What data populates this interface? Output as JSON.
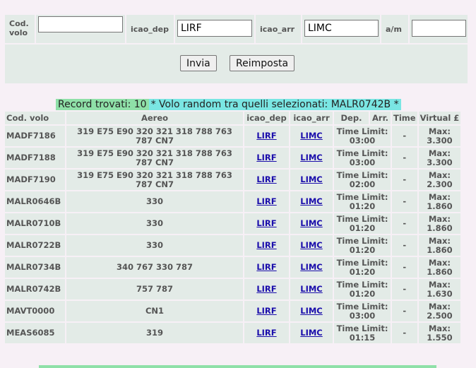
{
  "search": {
    "cod_volo_label_1": "Cod.",
    "cod_volo_label_2": "volo",
    "cod_volo_value": "",
    "icao_dep_label": "icao_dep",
    "icao_dep_value": "LIRF",
    "icao_arr_label": "icao_arr",
    "icao_arr_value": "LIMC",
    "am_label": "a/m",
    "am_value": ""
  },
  "buttons": {
    "submit": "Invia",
    "reset": "Reimposta"
  },
  "banner": {
    "records": "Record trovati: 10",
    "random": "* Volo random tra quelli selezionati: MALR0742B *"
  },
  "table": {
    "headers": [
      "Cod. volo",
      "Aereo",
      "icao_dep",
      "icao_arr",
      "Dep.",
      "Arr.",
      "Time",
      "Virtual £"
    ],
    "rows": [
      {
        "code": "MADF7186",
        "aereo": "319 E75 E90 320 321 318 788 763 787 CN7",
        "dep": "LIRF",
        "arr": "LIMC",
        "tl": "Time Limit:",
        "tv": "03:00",
        "time": "-",
        "max": "Max:",
        "mv": "3.300"
      },
      {
        "code": "MADF7188",
        "aereo": "319 E75 E90 320 321 318 788 763 787 CN7",
        "dep": "LIRF",
        "arr": "LIMC",
        "tl": "Time Limit:",
        "tv": "03:00",
        "time": "-",
        "max": "Max:",
        "mv": "3.300"
      },
      {
        "code": "MADF7190",
        "aereo": "319 E75 E90 320 321 318 788 763 787 CN7",
        "dep": "LIRF",
        "arr": "LIMC",
        "tl": "Time Limit:",
        "tv": "02:00",
        "time": "-",
        "max": "Max:",
        "mv": "2.300"
      },
      {
        "code": "MALR0646B",
        "aereo": "330",
        "dep": "LIRF",
        "arr": "LIMC",
        "tl": "Time Limit:",
        "tv": "01:20",
        "time": "-",
        "max": "Max:",
        "mv": "1.860"
      },
      {
        "code": "MALR0710B",
        "aereo": "330",
        "dep": "LIRF",
        "arr": "LIMC",
        "tl": "Time Limit:",
        "tv": "01:20",
        "time": "-",
        "max": "Max:",
        "mv": "1.860"
      },
      {
        "code": "MALR0722B",
        "aereo": "330",
        "dep": "LIRF",
        "arr": "LIMC",
        "tl": "Time Limit:",
        "tv": "01:20",
        "time": "-",
        "max": "Max:",
        "mv": "1.860"
      },
      {
        "code": "MALR0734B",
        "aereo": "340 767 330 787",
        "dep": "LIRF",
        "arr": "LIMC",
        "tl": "Time Limit:",
        "tv": "01:20",
        "time": "-",
        "max": "Max:",
        "mv": "1.860"
      },
      {
        "code": "MALR0742B",
        "aereo": "757 787",
        "dep": "LIRF",
        "arr": "LIMC",
        "tl": "Time Limit:",
        "tv": "01:20",
        "time": "-",
        "max": "Max:",
        "mv": "1.630"
      },
      {
        "code": "MAVT0000",
        "aereo": "CN1",
        "dep": "LIRF",
        "arr": "LIMC",
        "tl": "Time Limit:",
        "tv": "03:00",
        "time": "-",
        "max": "Max:",
        "mv": "2.500"
      },
      {
        "code": "MEAS6085",
        "aereo": "319",
        "dep": "LIRF",
        "arr": "LIMC",
        "tl": "Time Limit:",
        "tv": "01:15",
        "time": "-",
        "max": "Max:",
        "mv": "1.550"
      }
    ]
  }
}
